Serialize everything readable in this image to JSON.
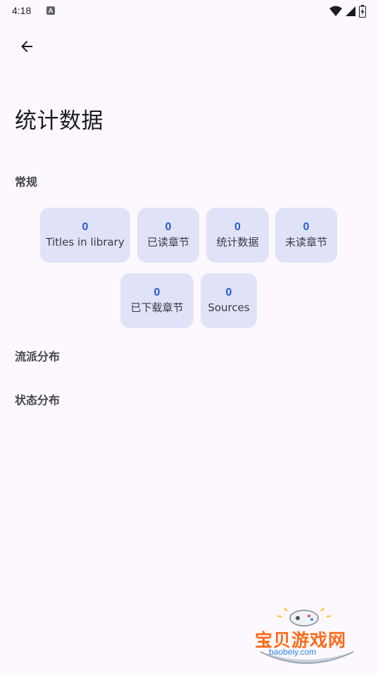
{
  "status_bar": {
    "time": "4:18",
    "notification_icon": "A",
    "icons": [
      "wifi-icon",
      "signal-icon",
      "battery-icon"
    ]
  },
  "toolbar": {
    "back_icon": "arrow-back-icon"
  },
  "page": {
    "title": "统计数据"
  },
  "sections": {
    "general": "常规",
    "genre_distribution": "流派分布",
    "status_distribution": "状态分布"
  },
  "stats": [
    {
      "value": "0",
      "label": "Titles in library"
    },
    {
      "value": "0",
      "label": "已读章节"
    },
    {
      "value": "0",
      "label": "统计数据"
    },
    {
      "value": "0",
      "label": "未读章节"
    },
    {
      "value": "0",
      "label": "已下载章节"
    },
    {
      "value": "0",
      "label": "Sources"
    }
  ],
  "watermark": {
    "text": "宝贝游戏网",
    "url": "baobeiy.com"
  },
  "colors": {
    "background": "#fdf8fd",
    "card": "#e0e3f8",
    "accent": "#2a5bc8",
    "watermark": "#ff6a1a"
  }
}
